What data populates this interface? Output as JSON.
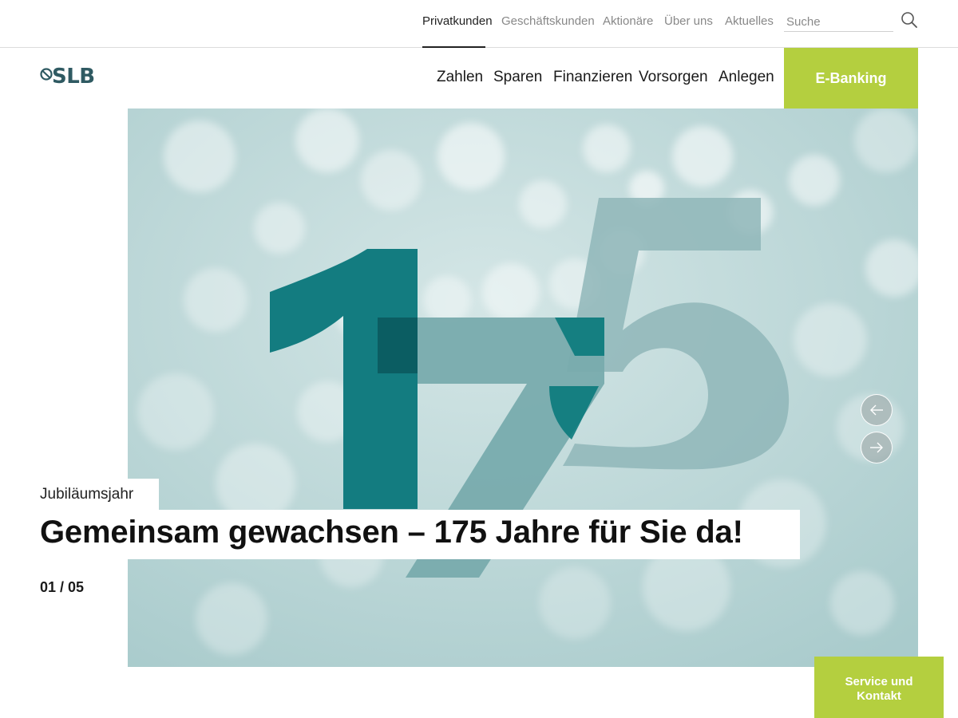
{
  "top_nav": {
    "items": [
      {
        "label": "Privatkunden",
        "active": true
      },
      {
        "label": "Geschäftskunden",
        "active": false
      },
      {
        "label": "Aktionäre",
        "active": false
      },
      {
        "label": "Über uns",
        "active": false
      },
      {
        "label": "Aktuelles",
        "active": false
      }
    ],
    "search": {
      "placeholder": "Suche",
      "value": "",
      "icon": "search-icon"
    }
  },
  "logo": {
    "text": "SLB",
    "icon": "globe-icon",
    "color": "#2f5a62"
  },
  "main_nav": {
    "items": [
      "Zahlen",
      "Sparen",
      "Finanzieren",
      "Vorsorgen",
      "Anlegen"
    ],
    "cta_label": "E-Banking",
    "cta_color": "#b4cf3f"
  },
  "hero": {
    "eyebrow": "Jubiläumsjahr",
    "headline": "Gemeinsam gewachsen – 175 Jahre für Sie da!",
    "counter": "01 / 05",
    "prev_icon": "arrow-left-icon",
    "next_icon": "arrow-right-icon",
    "colors": {
      "digit_dark": "#137c80",
      "digit_light": "#86b3b5",
      "background": "#b9d6d6"
    }
  },
  "service_button": {
    "label": "Service und Kontakt",
    "color": "#b4cf3f"
  }
}
